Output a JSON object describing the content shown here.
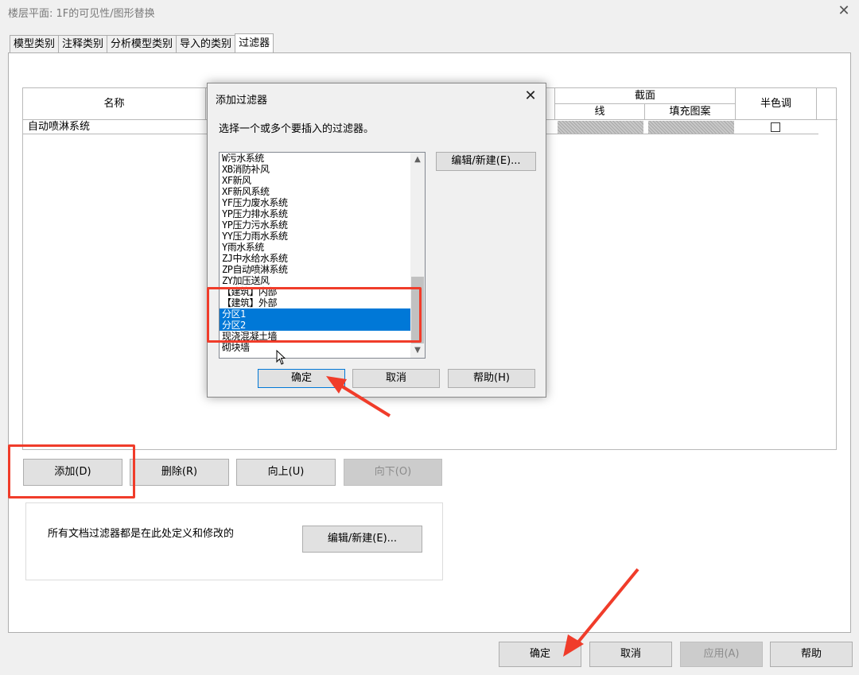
{
  "window": {
    "title": "楼层平面: 1F的可见性/图形替换"
  },
  "tabs": [
    {
      "label": "模型类别"
    },
    {
      "label": "注释类别"
    },
    {
      "label": "分析模型类别"
    },
    {
      "label": "导入的类别"
    },
    {
      "label": "过滤器"
    }
  ],
  "grid": {
    "col_name": "名称",
    "col_cut": "截面",
    "col_line": "线",
    "col_fill": "填充图案",
    "col_halftone": "半色调",
    "rows": [
      {
        "name": "自动喷淋系统"
      }
    ]
  },
  "buttons": {
    "add": "添加(D)",
    "delete": "删除(R)",
    "up": "向上(U)",
    "down": "向下(O)",
    "edit_new": "编辑/新建(E)...",
    "ok": "确定",
    "cancel": "取消",
    "apply": "应用(A)",
    "help": "帮助"
  },
  "info": {
    "text": "所有文档过滤器都是在此处定义和修改的"
  },
  "dialog": {
    "title": "添加过滤器",
    "prompt": "选择一个或多个要插入的过滤器。",
    "items": [
      "W污水系统",
      "XB消防补风",
      "XF新风",
      "XF新风系统",
      "YF压力废水系统",
      "YP压力排水系统",
      "YP压力污水系统",
      "YY压力雨水系统",
      "Y雨水系统",
      "ZJ中水给水系统",
      "ZP自动喷淋系统",
      "ZY加压送风",
      "【建筑】内部",
      "【建筑】外部",
      "分区1",
      "分区2",
      "现浇混凝土墙",
      "砌块墙"
    ],
    "selected": [
      "分区1",
      "分区2"
    ],
    "edit_new": "编辑/新建(E)...",
    "ok": "确定",
    "cancel": "取消",
    "help": "帮助(H)"
  },
  "colors": {
    "selection": "#0078d7",
    "highlight": "#f03c2a"
  }
}
